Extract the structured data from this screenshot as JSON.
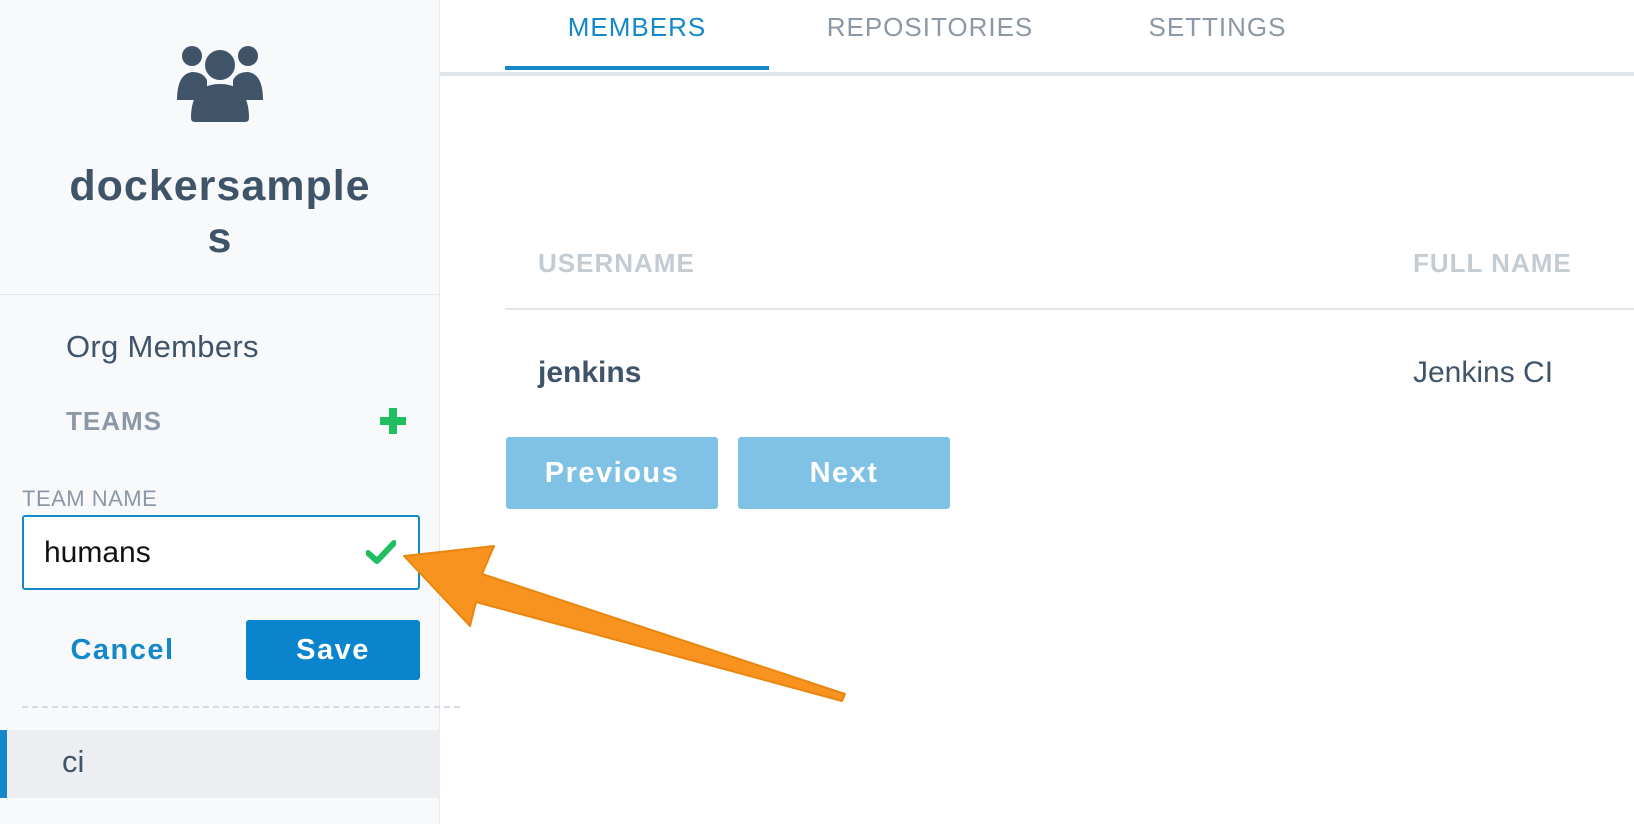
{
  "sidebar": {
    "org_icon": "users-group-icon",
    "org_name": "dockersamples",
    "org_members_label": "Org Members",
    "teams_heading": "TEAMS",
    "add_team_icon": "plus-icon",
    "team_form": {
      "label": "TEAM NAME",
      "value": "humans",
      "valid_icon": "check-icon",
      "cancel_label": "Cancel",
      "save_label": "Save"
    },
    "teams": [
      {
        "label": "ci",
        "selected": true
      }
    ]
  },
  "tabs": [
    {
      "label": "MEMBERS",
      "active": true
    },
    {
      "label": "REPOSITORIES",
      "active": false
    },
    {
      "label": "SETTINGS",
      "active": false
    }
  ],
  "members_table": {
    "columns": [
      "USERNAME",
      "FULL NAME"
    ],
    "rows": [
      {
        "username": "jenkins",
        "full_name": "Jenkins CI"
      }
    ]
  },
  "pagination": {
    "previous_label": "Previous",
    "next_label": "Next"
  },
  "annotation": {
    "icon": "arrow-annotation",
    "color": "#f7931e"
  },
  "colors": {
    "accent": "#1488c8",
    "save_button": "#0a84cc",
    "pagination_button": "#7fc2e6",
    "valid_green": "#1fbf5f",
    "text_dark": "#3f5469",
    "text_muted": "#8b98a7"
  }
}
